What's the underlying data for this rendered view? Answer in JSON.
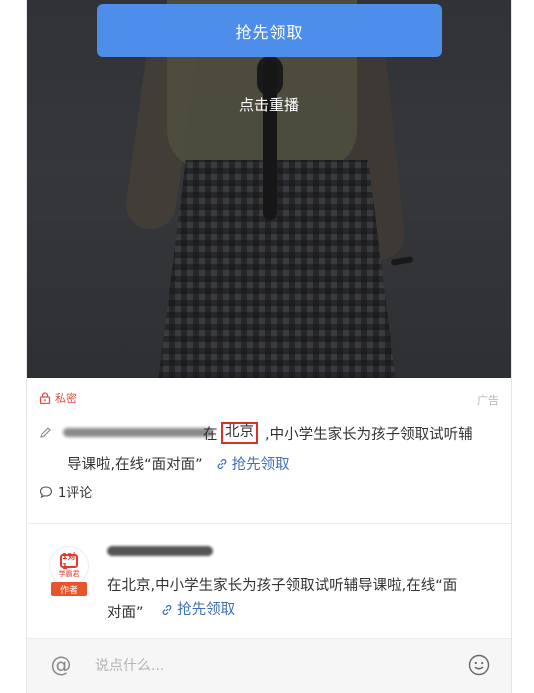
{
  "video": {
    "cta_label": "抢先领取",
    "replay_label": "点击重播"
  },
  "post": {
    "private_label": "私密",
    "ad_label": "广告",
    "text_prefix": "在",
    "text_highlight": "北京",
    "text_rest_line1": ",中小学生家长为孩子领取试听辅",
    "text_line2": "导课啦,在线“面对面”",
    "link_label": "抢先领取",
    "comments_label": "1评论"
  },
  "author_comment": {
    "badge": "作者",
    "avatar_logo": "1对1",
    "avatar_text": "学霸君",
    "text": "在北京,中小学生家长为孩子领取试听辅导课啦,在线“面对面”",
    "link_label": "抢先领取"
  },
  "input_bar": {
    "at_symbol": "@",
    "placeholder": "说点什么..."
  },
  "colors": {
    "accent": "#4d8eea",
    "private_red": "#e04f45",
    "link_blue": "#3f6fb5",
    "highlight_box": "#d9302a"
  }
}
